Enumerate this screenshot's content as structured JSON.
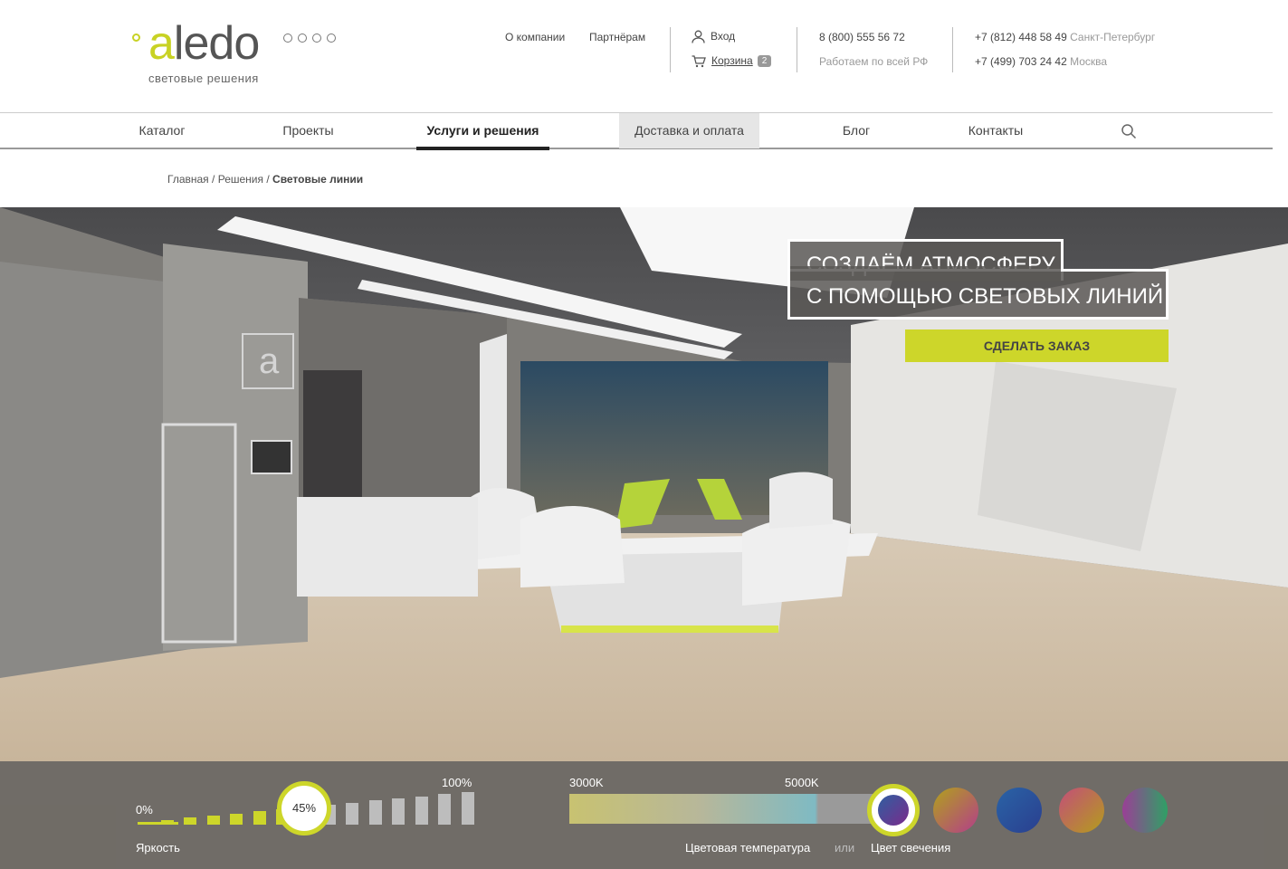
{
  "logo": {
    "name": "aledo",
    "tagline": "световые решения"
  },
  "header": {
    "links": [
      "О компании",
      "Партнёрам"
    ],
    "login": "Вход",
    "cart": {
      "label": "Корзина",
      "count": "2"
    },
    "phone_main": "8 (800) 555 56 72",
    "phone_main_note": "Работаем по всей РФ",
    "phones": [
      {
        "number": "+7 (812) 448 58 49",
        "city": "Санкт-Петербург"
      },
      {
        "number": "+7 (499) 703 24 42",
        "city": "Москва"
      }
    ]
  },
  "nav": {
    "items": [
      "Каталог",
      "Проекты",
      "Услуги и решения",
      "Доставка и оплата",
      "Блог",
      "Контакты"
    ],
    "active": "Услуги и решения",
    "highlighted": "Доставка и оплата"
  },
  "breadcrumbs": {
    "home": "Главная",
    "section": "Решения",
    "current": "Световые линии",
    "sep": "/"
  },
  "hero": {
    "headline_1": "СОЗДАЁМ АТМОСФЕРУ",
    "headline_2": "С ПОМОЩЬЮ СВЕТОВЫХ ЛИНИЙ",
    "cta": "СДЕЛАТЬ ЗАКАЗ"
  },
  "controls": {
    "brightness": {
      "label": "Яркость",
      "min_label": "0%",
      "max_label": "100%",
      "value_label": "45%",
      "value": 45
    },
    "temperature": {
      "label": "Цветовая температура",
      "min_label": "3000K",
      "max_label": "5000K"
    },
    "or_label": "или",
    "color": {
      "label": "Цвет свечения"
    }
  },
  "colors": {
    "accent": "#cdd62a"
  }
}
